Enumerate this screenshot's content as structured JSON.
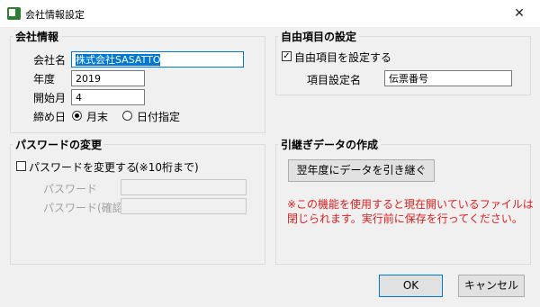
{
  "window": {
    "title": "会社情報設定",
    "close_glyph": "✕"
  },
  "company": {
    "group_title": "会社情報",
    "name_label": "会社名",
    "name_value": "株式会社SASATTO",
    "year_label": "年度",
    "year_value": "2019",
    "start_month_label": "開始月",
    "start_month_value": "4",
    "closing_label": "締め日",
    "closing_options": [
      {
        "label": "月末",
        "selected": true
      },
      {
        "label": "日付指定",
        "selected": false
      }
    ]
  },
  "custom": {
    "group_title": "自由項目の設定",
    "enable_label": "自由項目を設定する",
    "enable_checked": true,
    "item_label": "項目設定名",
    "item_value": "伝票番号"
  },
  "password": {
    "group_title": "パスワードの変更",
    "change_label": "パスワードを変更する",
    "change_checked": false,
    "hint": "(※10桁まで)",
    "password_label": "パスワード",
    "confirm_label": "パスワード(確認)"
  },
  "transfer": {
    "group_title": "引継ぎデータの作成",
    "button_label": "翌年度にデータを引き継ぐ",
    "warning_line1": "※この機能を使用すると現在開いているファイルは",
    "warning_line2": "閉じられます。実行前に保存を行ってください。"
  },
  "footer": {
    "ok_label": "OK",
    "cancel_label": "キャンセル"
  }
}
